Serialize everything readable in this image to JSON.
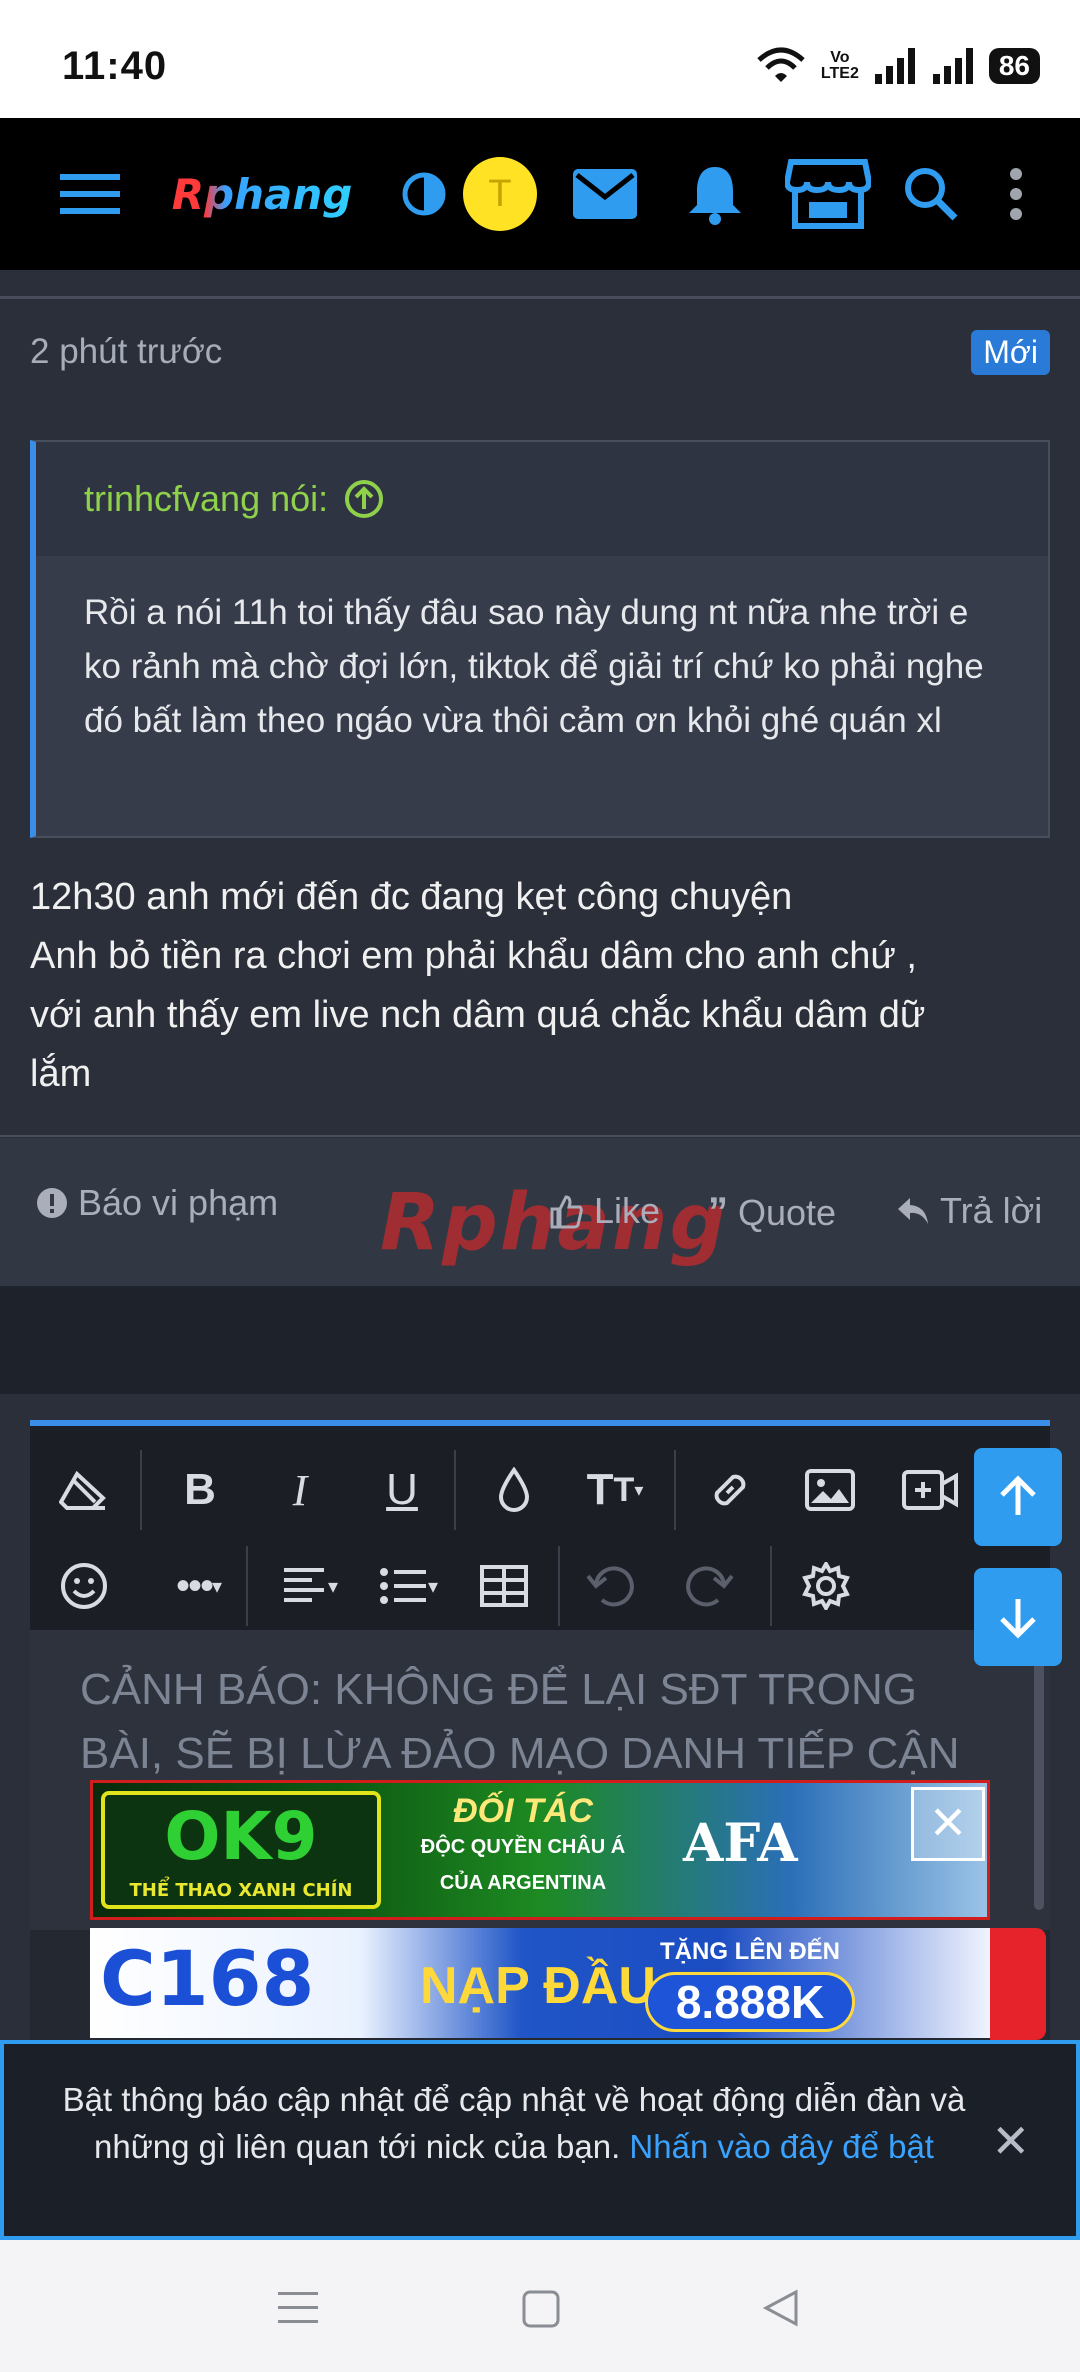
{
  "status_bar": {
    "time": "11:40",
    "network_label_top": "Vo",
    "network_label_bottom": "LTE2",
    "battery": "86"
  },
  "header": {
    "logo": "Rphang",
    "avatar_letter": "T",
    "icons": [
      "menu-icon",
      "theme-toggle-icon",
      "mail-icon",
      "bell-icon",
      "store-icon",
      "search-icon",
      "more-vert-icon"
    ]
  },
  "post": {
    "time": "2 phút trước",
    "badge": "Mới",
    "quote": {
      "author": "trinhcfvang nói:",
      "text": "Rồi a nói 11h toi thấy đâu sao này dung nt nữa nhe trời e ko rảnh mà chờ đợi lớn, tiktok để giải trí chứ ko phải nghe đó bất làm theo ngáo vừa thôi cảm ơn khỏi ghé quán xl"
    },
    "body_lines": [
      "12h30 anh mới đến đc đang kẹt công chuyện",
      "Anh bỏ tiền ra chơi em phải khẩu dâm cho anh chứ ,",
      "với anh thấy em live nch dâm quá chắc khẩu dâm dữ",
      "lắm"
    ],
    "actions": {
      "report": "Báo vi phạm",
      "like": "Like",
      "quote": "Quote",
      "reply": "Trả lời"
    },
    "watermark": "Rphang"
  },
  "editor": {
    "placeholder_line1": "CẢNH BÁO: KHÔNG ĐỂ LẠI SĐT TRONG",
    "placeholder_line2": "BÀI, SẼ BỊ LỪA ĐẢO MẠO DANH TIẾP CẬN"
  },
  "ads": {
    "ad1": {
      "brand": "OK9",
      "tagline": "THỂ THAO XANH CHÍN",
      "line1": "ĐỐI TÁC",
      "line2": "ĐỘC QUYỀN CHÂU Á",
      "line3": "CỦA ARGENTINA",
      "partner": "AFA"
    },
    "ad2": {
      "brand": "C168",
      "promo": "NẠP ĐẦU",
      "promo_label": "TẶNG LÊN ĐẾN",
      "amount": "8.888K"
    }
  },
  "notification": {
    "text": "Bật thông báo cập nhật để cập nhật về hoạt động diễn đàn và những gì liên quan tới nick của bạn.",
    "link": "Nhấn vào đây để bật"
  },
  "colors": {
    "accent": "#2f9cf0",
    "quote_author": "#8fd14a",
    "badge": "#2a7bd8",
    "header_bg": "#000000",
    "page_bg": "#2b2f3a"
  }
}
